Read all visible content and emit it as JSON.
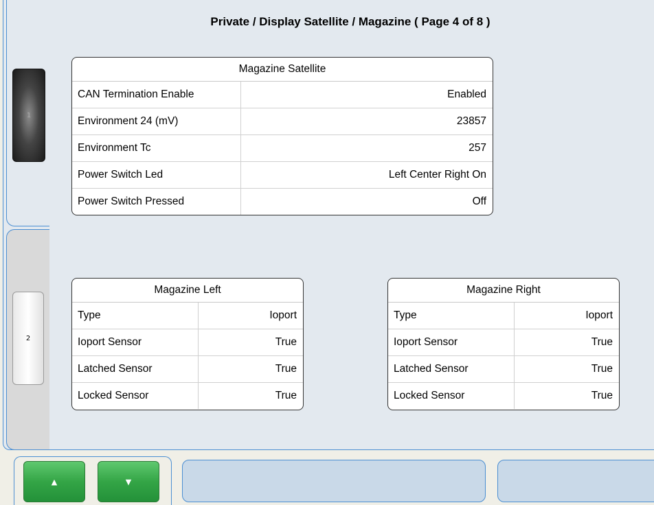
{
  "header": {
    "title": "Private / Display Satellite / Magazine ( Page 4 of 8 )"
  },
  "side_tabs": [
    {
      "label": "1"
    },
    {
      "label": "2"
    }
  ],
  "satellite": {
    "title": "Magazine Satellite",
    "rows": [
      {
        "label": "CAN Termination Enable",
        "value": "Enabled"
      },
      {
        "label": "Environment 24 (mV)",
        "value": "23857"
      },
      {
        "label": "Environment Tc",
        "value": "257"
      },
      {
        "label": "Power Switch Led",
        "value": "Left Center Right On"
      },
      {
        "label": "Power Switch Pressed",
        "value": "Off"
      }
    ]
  },
  "left": {
    "title": "Magazine Left",
    "rows": [
      {
        "label": "Type",
        "value": "Ioport"
      },
      {
        "label": "Ioport Sensor",
        "value": "True"
      },
      {
        "label": "Latched Sensor",
        "value": "True"
      },
      {
        "label": "Locked Sensor",
        "value": "True"
      }
    ]
  },
  "right": {
    "title": "Magazine Right",
    "rows": [
      {
        "label": "Type",
        "value": "Ioport"
      },
      {
        "label": "Ioport Sensor",
        "value": "True"
      },
      {
        "label": "Latched Sensor",
        "value": "True"
      },
      {
        "label": "Locked Sensor",
        "value": "True"
      }
    ]
  },
  "nav": {
    "up_glyph": "▲",
    "down_glyph": "▼",
    "up_icon": "arrow-up-icon",
    "down_icon": "arrow-down-icon"
  },
  "colors": {
    "accent_border": "#4a8ed2",
    "nav_green": "#34a546",
    "panel_bg": "#e3e9ef"
  }
}
